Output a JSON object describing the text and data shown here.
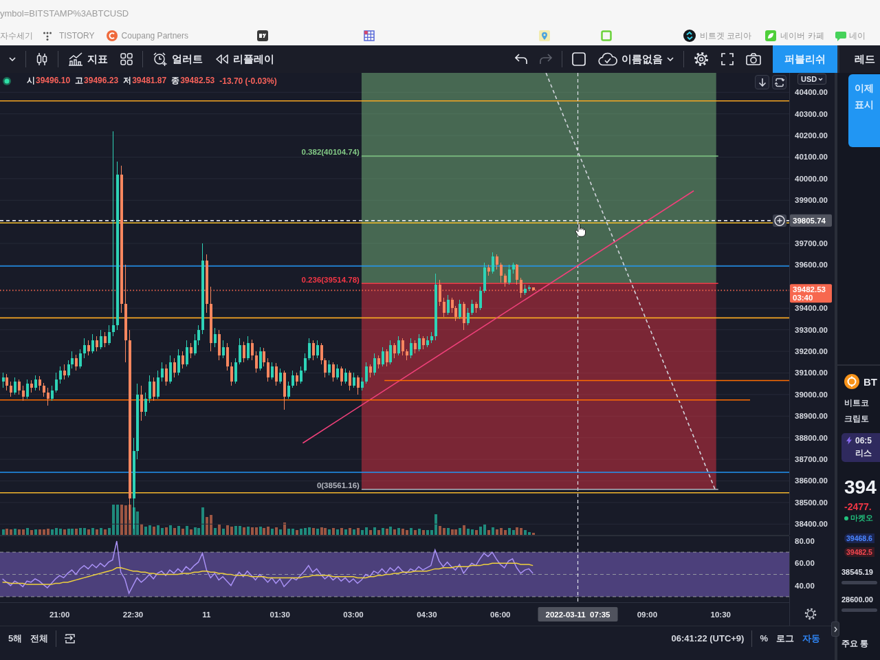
{
  "browser": {
    "address": "ymbol=BITSTAMP%3ABTCUSD",
    "bookmarks": [
      {
        "kind": "plain",
        "label": "자수세기"
      },
      {
        "kind": "dots",
        "label": "TISTORY"
      },
      {
        "kind": "c-circle",
        "label": "Coupang Partners"
      },
      {
        "kind": "tv-tile"
      },
      {
        "kind": "grid"
      },
      {
        "kind": "pin"
      },
      {
        "kind": "square"
      },
      {
        "kind": "swirl",
        "label": "비트겟 코리아"
      },
      {
        "kind": "leaf-tile",
        "label": "네이버 카페"
      },
      {
        "kind": "bubble",
        "label": "네이"
      }
    ]
  },
  "toolbar": {
    "indicators": "지표",
    "alert": "얼러트",
    "replay": "리플레이",
    "undo": {
      "disabled": false
    },
    "redo": {
      "disabled": true
    },
    "layout_name": "이름없음",
    "publish": "퍼블리쉬"
  },
  "chart": {
    "legend": {
      "items": [
        {
          "label": "시",
          "value": "39496.10"
        },
        {
          "label": "고",
          "value": "39496.23"
        },
        {
          "label": "저",
          "value": "39481.87"
        },
        {
          "label": "종",
          "value": "39482.53"
        }
      ],
      "change": "-13.70 (-0.03%)"
    },
    "currency": "USD",
    "chart_data": [
      {
        "type": "candlestick",
        "x": [
          "2022-03-10T19:50",
          "2022-03-10T19:55",
          "2022-03-10T20:00",
          "2022-03-10T20:05",
          "2022-03-10T20:10",
          "2022-03-10T20:15",
          "2022-03-10T20:20",
          "2022-03-10T20:25",
          "2022-03-10T20:30",
          "2022-03-10T20:35",
          "2022-03-10T20:40",
          "2022-03-10T20:45",
          "2022-03-10T20:50",
          "2022-03-10T20:55",
          "2022-03-10T21:00",
          "2022-03-10T21:05",
          "2022-03-10T21:10",
          "2022-03-10T21:15",
          "2022-03-10T21:20",
          "2022-03-10T21:25",
          "2022-03-10T21:30",
          "2022-03-10T21:35",
          "2022-03-10T21:40",
          "2022-03-10T21:45",
          "2022-03-10T21:50",
          "2022-03-10T21:55",
          "2022-03-10T22:00",
          "2022-03-10T22:05",
          "2022-03-10T22:10",
          "2022-03-10T22:15",
          "2022-03-10T22:20",
          "2022-03-10T22:25",
          "2022-03-10T22:30",
          "2022-03-10T22:35",
          "2022-03-10T22:40",
          "2022-03-10T22:45",
          "2022-03-10T22:50",
          "2022-03-10T22:55",
          "2022-03-10T23:00",
          "2022-03-10T23:05",
          "2022-03-10T23:10",
          "2022-03-10T23:15",
          "2022-03-10T23:20",
          "2022-03-10T23:25",
          "2022-03-10T23:30",
          "2022-03-10T23:35",
          "2022-03-10T23:40",
          "2022-03-10T23:45",
          "2022-03-10T23:50",
          "2022-03-10T23:55",
          "2022-03-11T00:00",
          "2022-03-11T00:05",
          "2022-03-11T00:10",
          "2022-03-11T00:15",
          "2022-03-11T00:20",
          "2022-03-11T00:25",
          "2022-03-11T00:30",
          "2022-03-11T00:35",
          "2022-03-11T00:40",
          "2022-03-11T00:45",
          "2022-03-11T00:50",
          "2022-03-11T00:55",
          "2022-03-11T01:00",
          "2022-03-11T01:05",
          "2022-03-11T01:10",
          "2022-03-11T01:15",
          "2022-03-11T01:20",
          "2022-03-11T01:25",
          "2022-03-11T01:30",
          "2022-03-11T01:35",
          "2022-03-11T01:40",
          "2022-03-11T01:45",
          "2022-03-11T01:50",
          "2022-03-11T01:55",
          "2022-03-11T02:00",
          "2022-03-11T02:05",
          "2022-03-11T02:10",
          "2022-03-11T02:15",
          "2022-03-11T02:20",
          "2022-03-11T02:25",
          "2022-03-11T02:30",
          "2022-03-11T02:35",
          "2022-03-11T02:40",
          "2022-03-11T02:45",
          "2022-03-11T02:50",
          "2022-03-11T02:55",
          "2022-03-11T03:00",
          "2022-03-11T03:05",
          "2022-03-11T03:10",
          "2022-03-11T03:15",
          "2022-03-11T03:20",
          "2022-03-11T03:25",
          "2022-03-11T03:30",
          "2022-03-11T03:35",
          "2022-03-11T03:40",
          "2022-03-11T03:45",
          "2022-03-11T03:50",
          "2022-03-11T03:55",
          "2022-03-11T04:00",
          "2022-03-11T04:05",
          "2022-03-11T04:10",
          "2022-03-11T04:15",
          "2022-03-11T04:20",
          "2022-03-11T04:25",
          "2022-03-11T04:30",
          "2022-03-11T04:35",
          "2022-03-11T04:40",
          "2022-03-11T04:45",
          "2022-03-11T04:50",
          "2022-03-11T04:55",
          "2022-03-11T05:00",
          "2022-03-11T05:05",
          "2022-03-11T05:10",
          "2022-03-11T05:15",
          "2022-03-11T05:20",
          "2022-03-11T05:25",
          "2022-03-11T05:30",
          "2022-03-11T05:35",
          "2022-03-11T05:40",
          "2022-03-11T05:45",
          "2022-03-11T05:50",
          "2022-03-11T05:55",
          "2022-03-11T06:00",
          "2022-03-11T06:05",
          "2022-03-11T06:10",
          "2022-03-11T06:15",
          "2022-03-11T06:20",
          "2022-03-11T06:25",
          "2022-03-11T06:30",
          "2022-03-11T06:35",
          "2022-03-11T06:40"
        ],
        "ohlc": [
          [
            39060,
            39100,
            39030,
            39080
          ],
          [
            39080,
            39095,
            39020,
            39040
          ],
          [
            39040,
            39060,
            38990,
            39010
          ],
          [
            39010,
            39080,
            39000,
            39060
          ],
          [
            39060,
            39070,
            39000,
            39020
          ],
          [
            39020,
            39040,
            38970,
            38990
          ],
          [
            38990,
            39070,
            38980,
            39050
          ],
          [
            39050,
            39065,
            39010,
            39030
          ],
          [
            39030,
            39090,
            39020,
            39070
          ],
          [
            39070,
            39085,
            39020,
            39040
          ],
          [
            39040,
            39055,
            38990,
            39010
          ],
          [
            39010,
            39030,
            38950,
            38980
          ],
          [
            38980,
            39040,
            38970,
            39020
          ],
          [
            39020,
            39100,
            39010,
            39070
          ],
          [
            39070,
            39130,
            39050,
            39110
          ],
          [
            39110,
            39140,
            39070,
            39090
          ],
          [
            39090,
            39160,
            39080,
            39140
          ],
          [
            39140,
            39200,
            39120,
            39170
          ],
          [
            39170,
            39185,
            39110,
            39130
          ],
          [
            39130,
            39210,
            39120,
            39190
          ],
          [
            39190,
            39260,
            39170,
            39230
          ],
          [
            39230,
            39250,
            39180,
            39200
          ],
          [
            39200,
            39280,
            39190,
            39250
          ],
          [
            39250,
            39270,
            39200,
            39220
          ],
          [
            39220,
            39300,
            39210,
            39270
          ],
          [
            39270,
            39290,
            39220,
            39240
          ],
          [
            39240,
            39320,
            39230,
            39290
          ],
          [
            39290,
            40220,
            39270,
            39320
          ],
          [
            39320,
            40080,
            39300,
            40020
          ],
          [
            40020,
            40060,
            39380,
            39420
          ],
          [
            39420,
            39600,
            39150,
            39250
          ],
          [
            39250,
            39300,
            38420,
            38520
          ],
          [
            38520,
            38800,
            38380,
            38740
          ],
          [
            38740,
            39050,
            38700,
            39000
          ],
          [
            39000,
            39040,
            38880,
            38920
          ],
          [
            38920,
            39010,
            38900,
            38980
          ],
          [
            38980,
            39090,
            38960,
            39060
          ],
          [
            39060,
            39080,
            38970,
            38990
          ],
          [
            38990,
            39110,
            38980,
            39080
          ],
          [
            39080,
            39150,
            39060,
            39120
          ],
          [
            39120,
            39140,
            39040,
            39060
          ],
          [
            39060,
            39180,
            39050,
            39150
          ],
          [
            39150,
            39170,
            39080,
            39100
          ],
          [
            39100,
            39210,
            39090,
            39180
          ],
          [
            39180,
            39200,
            39120,
            39140
          ],
          [
            39140,
            39250,
            39130,
            39220
          ],
          [
            39220,
            39240,
            39170,
            39190
          ],
          [
            39190,
            39280,
            39180,
            39250
          ],
          [
            39250,
            39320,
            39230,
            39300
          ],
          [
            39300,
            39700,
            39280,
            39620
          ],
          [
            39620,
            39650,
            39380,
            39420
          ],
          [
            39420,
            39500,
            39200,
            39240
          ],
          [
            39240,
            39310,
            39220,
            39280
          ],
          [
            39280,
            39300,
            39160,
            39180
          ],
          [
            39180,
            39250,
            39170,
            39220
          ],
          [
            39220,
            39240,
            39110,
            39130
          ],
          [
            39130,
            39150,
            39040,
            39060
          ],
          [
            39060,
            39170,
            39050,
            39150
          ],
          [
            39150,
            39260,
            39140,
            39230
          ],
          [
            39230,
            39245,
            39150,
            39170
          ],
          [
            39170,
            39270,
            39160,
            39240
          ],
          [
            39240,
            39255,
            39160,
            39180
          ],
          [
            39180,
            39200,
            39100,
            39120
          ],
          [
            39120,
            39220,
            39110,
            39200
          ],
          [
            39200,
            39215,
            39130,
            39150
          ],
          [
            39150,
            39170,
            39060,
            39080
          ],
          [
            39080,
            39150,
            39070,
            39130
          ],
          [
            39130,
            39145,
            39040,
            39060
          ],
          [
            39060,
            39120,
            39050,
            39100
          ],
          [
            39100,
            39110,
            38930,
            38990
          ],
          [
            38990,
            39060,
            38980,
            39040
          ],
          [
            39040,
            39110,
            39030,
            39090
          ],
          [
            39090,
            39100,
            39040,
            39060
          ],
          [
            39060,
            39130,
            39050,
            39110
          ],
          [
            39110,
            39190,
            39100,
            39170
          ],
          [
            39170,
            39260,
            39160,
            39240
          ],
          [
            39240,
            39250,
            39160,
            39180
          ],
          [
            39180,
            39250,
            39170,
            39230
          ],
          [
            39230,
            39240,
            39140,
            39160
          ],
          [
            39160,
            39170,
            39080,
            39100
          ],
          [
            39100,
            39160,
            39090,
            39140
          ],
          [
            39140,
            39150,
            39060,
            39080
          ],
          [
            39080,
            39140,
            39070,
            39120
          ],
          [
            39120,
            39130,
            39040,
            39060
          ],
          [
            39060,
            39120,
            39050,
            39100
          ],
          [
            39100,
            39110,
            39020,
            39040
          ],
          [
            39040,
            39100,
            39030,
            39080
          ],
          [
            39080,
            39090,
            39000,
            39030
          ],
          [
            39030,
            39080,
            39020,
            39060
          ],
          [
            39060,
            39150,
            39050,
            39130
          ],
          [
            39130,
            39140,
            39080,
            39100
          ],
          [
            39100,
            39190,
            39090,
            39170
          ],
          [
            39170,
            39180,
            39120,
            39140
          ],
          [
            39140,
            39220,
            39130,
            39200
          ],
          [
            39200,
            39210,
            39130,
            39150
          ],
          [
            39150,
            39250,
            39140,
            39230
          ],
          [
            39230,
            39240,
            39170,
            39190
          ],
          [
            39190,
            39270,
            39180,
            39250
          ],
          [
            39250,
            39260,
            39180,
            39200
          ],
          [
            39200,
            39210,
            39160,
            39180
          ],
          [
            39180,
            39260,
            39170,
            39240
          ],
          [
            39240,
            39250,
            39190,
            39210
          ],
          [
            39210,
            39280,
            39200,
            39260
          ],
          [
            39260,
            39270,
            39210,
            39230
          ],
          [
            39230,
            39270,
            39220,
            39250
          ],
          [
            39250,
            39290,
            39240,
            39270
          ],
          [
            39270,
            39560,
            39250,
            39510
          ],
          [
            39510,
            39530,
            39410,
            39430
          ],
          [
            39430,
            39450,
            39360,
            39380
          ],
          [
            39380,
            39460,
            39370,
            39440
          ],
          [
            39440,
            39450,
            39380,
            39400
          ],
          [
            39400,
            39410,
            39340,
            39360
          ],
          [
            39360,
            39440,
            39350,
            39420
          ],
          [
            39420,
            39430,
            39300,
            39330
          ],
          [
            39330,
            39400,
            39320,
            39380
          ],
          [
            39380,
            39440,
            39370,
            39420
          ],
          [
            39420,
            39430,
            39380,
            39400
          ],
          [
            39400,
            39500,
            39390,
            39480
          ],
          [
            39480,
            39610,
            39470,
            39590
          ],
          [
            39590,
            39600,
            39550,
            39570
          ],
          [
            39570,
            39660,
            39560,
            39640
          ],
          [
            39640,
            39650,
            39580,
            39600
          ],
          [
            39600,
            39610,
            39520,
            39550
          ],
          [
            39550,
            39560,
            39500,
            39520
          ],
          [
            39520,
            39600,
            39510,
            39580
          ],
          [
            39580,
            39610,
            39560,
            39600
          ],
          [
            39600,
            39605,
            39510,
            39530
          ],
          [
            39530,
            39540,
            39450,
            39470
          ],
          [
            39470,
            39510,
            39460,
            39490
          ],
          [
            39490,
            39505,
            39480,
            39496.1
          ],
          [
            39496.1,
            39496.23,
            39481.87,
            39482.53
          ]
        ],
        "series": [
          {
            "name": "0(38561.16)",
            "type": "line",
            "x": [
              "2022-03-11T03:10",
              "2022-03-11T10:27"
            ],
            "values": [
              38561.16,
              38561.16
            ],
            "color": "#b2b5be"
          },
          {
            "name": "0.236(39514.78)",
            "type": "line",
            "x": [
              "2022-03-11T03:10",
              "2022-03-11T10:27"
            ],
            "values": [
              39514.78,
              39514.78
            ],
            "color": "#f23645"
          },
          {
            "name": "0.382(40104.74)",
            "type": "line",
            "x": [
              "2022-03-11T03:10",
              "2022-03-11T10:27"
            ],
            "values": [
              40104.74,
              40104.74
            ],
            "color": "#81c784"
          },
          {
            "type": "line",
            "x": [
              "2022-03-11T06:56",
              "2022-03-11T10:23"
            ],
            "values": [
              40490,
              38561.16
            ],
            "color": "#d1d4dc",
            "line_style": "dashed"
          },
          {
            "type": "line",
            "x": [
              "2022-03-11T01:58",
              "2022-03-11T09:57"
            ],
            "values": [
              38775,
              39944
            ],
            "color": "#f0407a"
          },
          {
            "type": "line",
            "x": [
              "2022-03-11T03:38",
              "2022-03-11T11:54"
            ],
            "values": [
              39065,
              39065
            ],
            "color": "#ff6d00"
          },
          {
            "type": "line",
            "x": [
              "2022-03-10T19:47",
              "2022-03-11T11:06"
            ],
            "values": [
              38975,
              38975
            ],
            "color": "#ff6d00"
          }
        ],
        "xlim": [
          "2022-03-10T19:47",
          "2022-03-11T11:54"
        ],
        "ylim": [
          38350,
          40490
        ],
        "yticks": [
          {
            "value": 40400,
            "label": "40400.00"
          },
          {
            "value": 40300,
            "label": "40300.00"
          },
          {
            "value": 40200,
            "label": "40200.00"
          },
          {
            "value": 40100,
            "label": "40100.00"
          },
          {
            "value": 40000,
            "label": "40000.00"
          },
          {
            "value": 39900,
            "label": "39900.00"
          },
          {
            "value": 39700,
            "label": "39700.00"
          },
          {
            "value": 39600,
            "label": "39600.00"
          },
          {
            "value": 39400,
            "label": "39400.00"
          },
          {
            "value": 39300,
            "label": "39300.00"
          },
          {
            "value": 39200,
            "label": "39200.00"
          },
          {
            "value": 39100,
            "label": "39100.00"
          },
          {
            "value": 39000,
            "label": "39000.00"
          },
          {
            "value": 38900,
            "label": "38900.00"
          },
          {
            "value": 38800,
            "label": "38800.00"
          },
          {
            "value": 38700,
            "label": "38700.00"
          },
          {
            "value": 38600,
            "label": "38600.00"
          },
          {
            "value": 38500,
            "label": "38500.00"
          },
          {
            "value": 38400,
            "label": "38400.00"
          }
        ],
        "grid": true,
        "ref_lines": [
          {
            "axis": "y",
            "value": 40360,
            "color": "#f5a623",
            "line_style": "solid"
          },
          {
            "axis": "y",
            "value": 39795,
            "color": "#f5c02e",
            "line_style": "solid"
          },
          {
            "axis": "y",
            "value": 39805.74,
            "label": "39805.74",
            "color": "#e0e3eb",
            "line_style": "dashed"
          },
          {
            "axis": "y",
            "value": 39595,
            "color": "#2196f3",
            "line_style": "solid"
          },
          {
            "axis": "y",
            "value": 39482.53,
            "label": "39482.53",
            "color": "#f7684f",
            "line_style": "dotted"
          },
          {
            "axis": "y",
            "value": 39355,
            "color": "#f5a623",
            "line_style": "solid"
          },
          {
            "axis": "y",
            "value": 38640,
            "color": "#2196f3",
            "line_style": "solid"
          },
          {
            "axis": "y",
            "value": 38545,
            "color": "#f5b82e",
            "line_style": "solid"
          },
          {
            "axis": "x",
            "value": "2022-03-11T07:35",
            "color": "#e0e3eb",
            "line_style": "dashed"
          }
        ],
        "annotations": [
          "03:40"
        ]
      },
      {
        "type": "line",
        "x": [
          "2022-03-10T19:50",
          "2022-03-10T19:55",
          "2022-03-10T20:00",
          "2022-03-10T20:05",
          "2022-03-10T20:10",
          "2022-03-10T20:15",
          "2022-03-10T20:20",
          "2022-03-10T20:25",
          "2022-03-10T20:30",
          "2022-03-10T20:35",
          "2022-03-10T20:40",
          "2022-03-10T20:45",
          "2022-03-10T20:50",
          "2022-03-10T20:55",
          "2022-03-10T21:00",
          "2022-03-10T21:05",
          "2022-03-10T21:10",
          "2022-03-10T21:15",
          "2022-03-10T21:20",
          "2022-03-10T21:25",
          "2022-03-10T21:30",
          "2022-03-10T21:35",
          "2022-03-10T21:40",
          "2022-03-10T21:45",
          "2022-03-10T21:50",
          "2022-03-10T21:55",
          "2022-03-10T22:00",
          "2022-03-10T22:05",
          "2022-03-10T22:10",
          "2022-03-10T22:15",
          "2022-03-10T22:20",
          "2022-03-10T22:25",
          "2022-03-10T22:30",
          "2022-03-10T22:35",
          "2022-03-10T22:40",
          "2022-03-10T22:45",
          "2022-03-10T22:50",
          "2022-03-10T22:55",
          "2022-03-10T23:00",
          "2022-03-10T23:05",
          "2022-03-10T23:10",
          "2022-03-10T23:15",
          "2022-03-10T23:20",
          "2022-03-10T23:25",
          "2022-03-10T23:30",
          "2022-03-10T23:35",
          "2022-03-10T23:40",
          "2022-03-10T23:45",
          "2022-03-10T23:50",
          "2022-03-10T23:55",
          "2022-03-11T00:00",
          "2022-03-11T00:05",
          "2022-03-11T00:10",
          "2022-03-11T00:15",
          "2022-03-11T00:20",
          "2022-03-11T00:25",
          "2022-03-11T00:30",
          "2022-03-11T00:35",
          "2022-03-11T00:40",
          "2022-03-11T00:45",
          "2022-03-11T00:50",
          "2022-03-11T00:55",
          "2022-03-11T01:00",
          "2022-03-11T01:05",
          "2022-03-11T01:10",
          "2022-03-11T01:15",
          "2022-03-11T01:20",
          "2022-03-11T01:25",
          "2022-03-11T01:30",
          "2022-03-11T01:35",
          "2022-03-11T01:40",
          "2022-03-11T01:45",
          "2022-03-11T01:50",
          "2022-03-11T01:55",
          "2022-03-11T02:00",
          "2022-03-11T02:05",
          "2022-03-11T02:10",
          "2022-03-11T02:15",
          "2022-03-11T02:20",
          "2022-03-11T02:25",
          "2022-03-11T02:30",
          "2022-03-11T02:35",
          "2022-03-11T02:40",
          "2022-03-11T02:45",
          "2022-03-11T02:50",
          "2022-03-11T02:55",
          "2022-03-11T03:00",
          "2022-03-11T03:05",
          "2022-03-11T03:10",
          "2022-03-11T03:15",
          "2022-03-11T03:20",
          "2022-03-11T03:25",
          "2022-03-11T03:30",
          "2022-03-11T03:35",
          "2022-03-11T03:40",
          "2022-03-11T03:45",
          "2022-03-11T03:50",
          "2022-03-11T03:55",
          "2022-03-11T04:00",
          "2022-03-11T04:05",
          "2022-03-11T04:10",
          "2022-03-11T04:15",
          "2022-03-11T04:20",
          "2022-03-11T04:25",
          "2022-03-11T04:30",
          "2022-03-11T04:35",
          "2022-03-11T04:40",
          "2022-03-11T04:45",
          "2022-03-11T04:50",
          "2022-03-11T04:55",
          "2022-03-11T05:00",
          "2022-03-11T05:05",
          "2022-03-11T05:10",
          "2022-03-11T05:15",
          "2022-03-11T05:20",
          "2022-03-11T05:25",
          "2022-03-11T05:30",
          "2022-03-11T05:35",
          "2022-03-11T05:40",
          "2022-03-11T05:45",
          "2022-03-11T05:50",
          "2022-03-11T05:55",
          "2022-03-11T06:00",
          "2022-03-11T06:05",
          "2022-03-11T06:10",
          "2022-03-11T06:15",
          "2022-03-11T06:20",
          "2022-03-11T06:25",
          "2022-03-11T06:30",
          "2022-03-11T06:35",
          "2022-03-11T06:40"
        ],
        "series": [
          {
            "color": "#a991f5",
            "values": [
              46,
              43,
              40,
              44,
              42,
              39,
              44,
              43,
              46,
              44,
              41,
              38,
              42,
              46,
              49,
              47,
              51,
              54,
              50,
              55,
              58,
              55,
              59,
              56,
              60,
              57,
              61,
              63,
              80,
              52,
              46,
              33,
              40,
              47,
              43,
              46,
              50,
              46,
              51,
              53,
              49,
              54,
              51,
              55,
              52,
              57,
              54,
              58,
              61,
              69,
              54,
              47,
              51,
              45,
              48,
              44,
              40,
              47,
              52,
              48,
              53,
              49,
              45,
              50,
              47,
              43,
              47,
              42,
              46,
              39,
              43,
              47,
              45,
              49,
              53,
              58,
              52,
              55,
              50,
              46,
              49,
              45,
              48,
              44,
              47,
              43,
              46,
              42,
              45,
              50,
              48,
              53,
              51,
              55,
              51,
              56,
              53,
              57,
              53,
              51,
              55,
              53,
              57,
              54,
              56,
              58,
              72,
              62,
              57,
              61,
              57,
              54,
              59,
              51,
              56,
              60,
              58,
              64,
              69,
              66,
              70,
              64,
              59,
              56,
              62,
              64,
              56,
              51,
              54,
              55,
              51
            ]
          },
          {
            "color": "#f0d23c",
            "values": [
              43,
              43,
              42,
              42,
              42,
              42,
              41,
              41,
              41,
              41,
              41,
              41,
              41,
              42,
              42,
              43,
              43,
              44,
              45,
              46,
              47,
              48,
              49,
              50,
              51,
              52,
              53,
              54,
              56,
              56,
              55,
              54,
              53,
              53,
              52,
              52,
              51,
              51,
              50,
              50,
              50,
              50,
              50,
              50,
              51,
              51,
              51,
              52,
              52,
              53,
              53,
              52,
              52,
              51,
              51,
              50,
              50,
              49,
              49,
              49,
              49,
              48,
              48,
              48,
              48,
              47,
              47,
              47,
              47,
              47,
              47,
              47,
              47,
              47,
              48,
              48,
              49,
              49,
              49,
              49,
              49,
              48,
              48,
              48,
              48,
              48,
              48,
              47,
              47,
              47,
              48,
              48,
              49,
              49,
              50,
              50,
              51,
              51,
              52,
              52,
              52,
              53,
              53,
              53,
              53,
              54,
              55,
              55,
              56,
              56,
              56,
              57,
              57,
              57,
              57,
              58,
              58,
              58,
              59,
              59,
              60,
              60,
              60,
              60,
              60,
              60,
              60,
              59,
              59,
              59,
              58
            ]
          }
        ],
        "xlim": [
          "2022-03-10T19:47",
          "2022-03-11T11:54"
        ],
        "ylim": [
          25,
          84.3
        ],
        "xticks": [
          {
            "value": "2022-03-10T21:00",
            "label": "21:00"
          },
          {
            "value": "2022-03-10T22:30",
            "label": "22:30"
          },
          {
            "value": "2022-03-11T00:00",
            "label": "11"
          },
          {
            "value": "2022-03-11T01:30",
            "label": "01:30"
          },
          {
            "value": "2022-03-11T03:00",
            "label": "03:00"
          },
          {
            "value": "2022-03-11T04:30",
            "label": "04:30"
          },
          {
            "value": "2022-03-11T06:00",
            "label": "06:00"
          },
          {
            "value": "2022-03-11T09:00",
            "label": "09:00"
          },
          {
            "value": "2022-03-11T10:30",
            "label": "10:30"
          }
        ],
        "yticks": [
          {
            "value": 80,
            "label": "80.00"
          },
          {
            "value": 60,
            "label": "60.00"
          },
          {
            "value": 40,
            "label": "40.00"
          }
        ],
        "bands": [
          {
            "axis": "y",
            "from": 30,
            "to": 70,
            "color": "#8c6fe0"
          }
        ],
        "ref_lines": [
          {
            "axis": "y",
            "value": 70,
            "color": "#9598a1",
            "line_style": "dashed"
          },
          {
            "axis": "y",
            "value": 50,
            "color": "#9598a1",
            "line_style": "dashed"
          },
          {
            "axis": "y",
            "value": 30,
            "color": "#9598a1",
            "line_style": "dashed"
          },
          {
            "axis": "x",
            "value": "2022-03-11T07:35",
            "label": "2022-03-11  07:35",
            "color": "#e0e3eb",
            "line_style": "dashed"
          }
        ]
      }
    ]
  },
  "bottom_bar": {
    "ranges": [
      {
        "label": "5해",
        "selected": false
      },
      {
        "label": "전체",
        "selected": false
      }
    ],
    "timezone": "06:41:22 (UTC+9)",
    "scale_modes": [
      {
        "label": "%",
        "selected": false
      },
      {
        "label": "로그",
        "selected": false
      },
      {
        "label": "자동",
        "selected": true
      }
    ]
  },
  "sidebar": {
    "title": "레드",
    "notice": [
      "이제",
      "표시"
    ],
    "symbol": {
      "ticker": "BT",
      "name": "비트코",
      "type": "크립토"
    },
    "event": {
      "time": "06:5",
      "text": "리스"
    },
    "price": "394",
    "change": "-2477.",
    "status": "마켓오",
    "bid": "39468.6",
    "ask": "39482.5",
    "stats": [
      "38545.19",
      "28600.00"
    ],
    "section": "주요 통"
  }
}
